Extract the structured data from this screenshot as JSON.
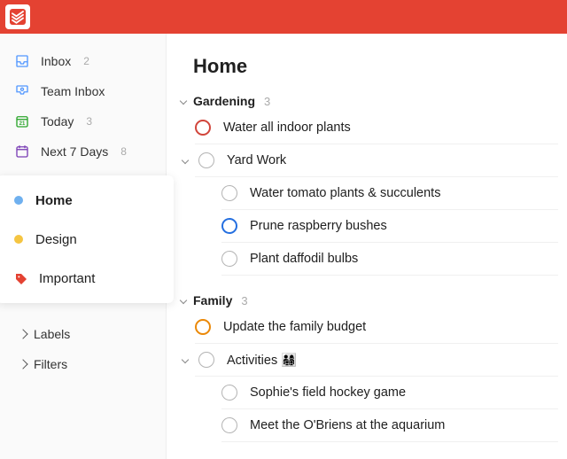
{
  "app": {
    "brand_color": "#e44232"
  },
  "sidebar": {
    "inbox": {
      "label": "Inbox",
      "count": "2"
    },
    "team_inbox": {
      "label": "Team Inbox"
    },
    "today": {
      "label": "Today",
      "count": "3"
    },
    "next7": {
      "label": "Next 7 Days",
      "count": "8"
    },
    "projects": [
      {
        "label": "Home",
        "color": "#6fb0ef",
        "selected": true
      },
      {
        "label": "Design",
        "color": "#f5c542"
      },
      {
        "label": "Important",
        "tag_color": "#e44232"
      }
    ],
    "meta": {
      "labels": "Labels",
      "filters": "Filters"
    }
  },
  "page": {
    "title": "Home",
    "sections": [
      {
        "name": "Gardening",
        "count": "3",
        "tasks": [
          {
            "label": "Water all indoor plants",
            "priority": "p1"
          },
          {
            "label": "Yard Work",
            "group": true,
            "children": [
              {
                "label": "Water tomato plants & succulents"
              },
              {
                "label": "Prune raspberry bushes",
                "priority": "p3"
              },
              {
                "label": "Plant daffodil bulbs"
              }
            ]
          }
        ]
      },
      {
        "name": "Family",
        "count": "3",
        "tasks": [
          {
            "label": "Update the family budget",
            "priority": "p2"
          },
          {
            "label": "Activities 👨‍👩‍👧‍👦",
            "group": true,
            "children": [
              {
                "label": "Sophie's field hockey game"
              },
              {
                "label": "Meet the O'Briens at the aquarium"
              }
            ]
          }
        ]
      }
    ]
  }
}
